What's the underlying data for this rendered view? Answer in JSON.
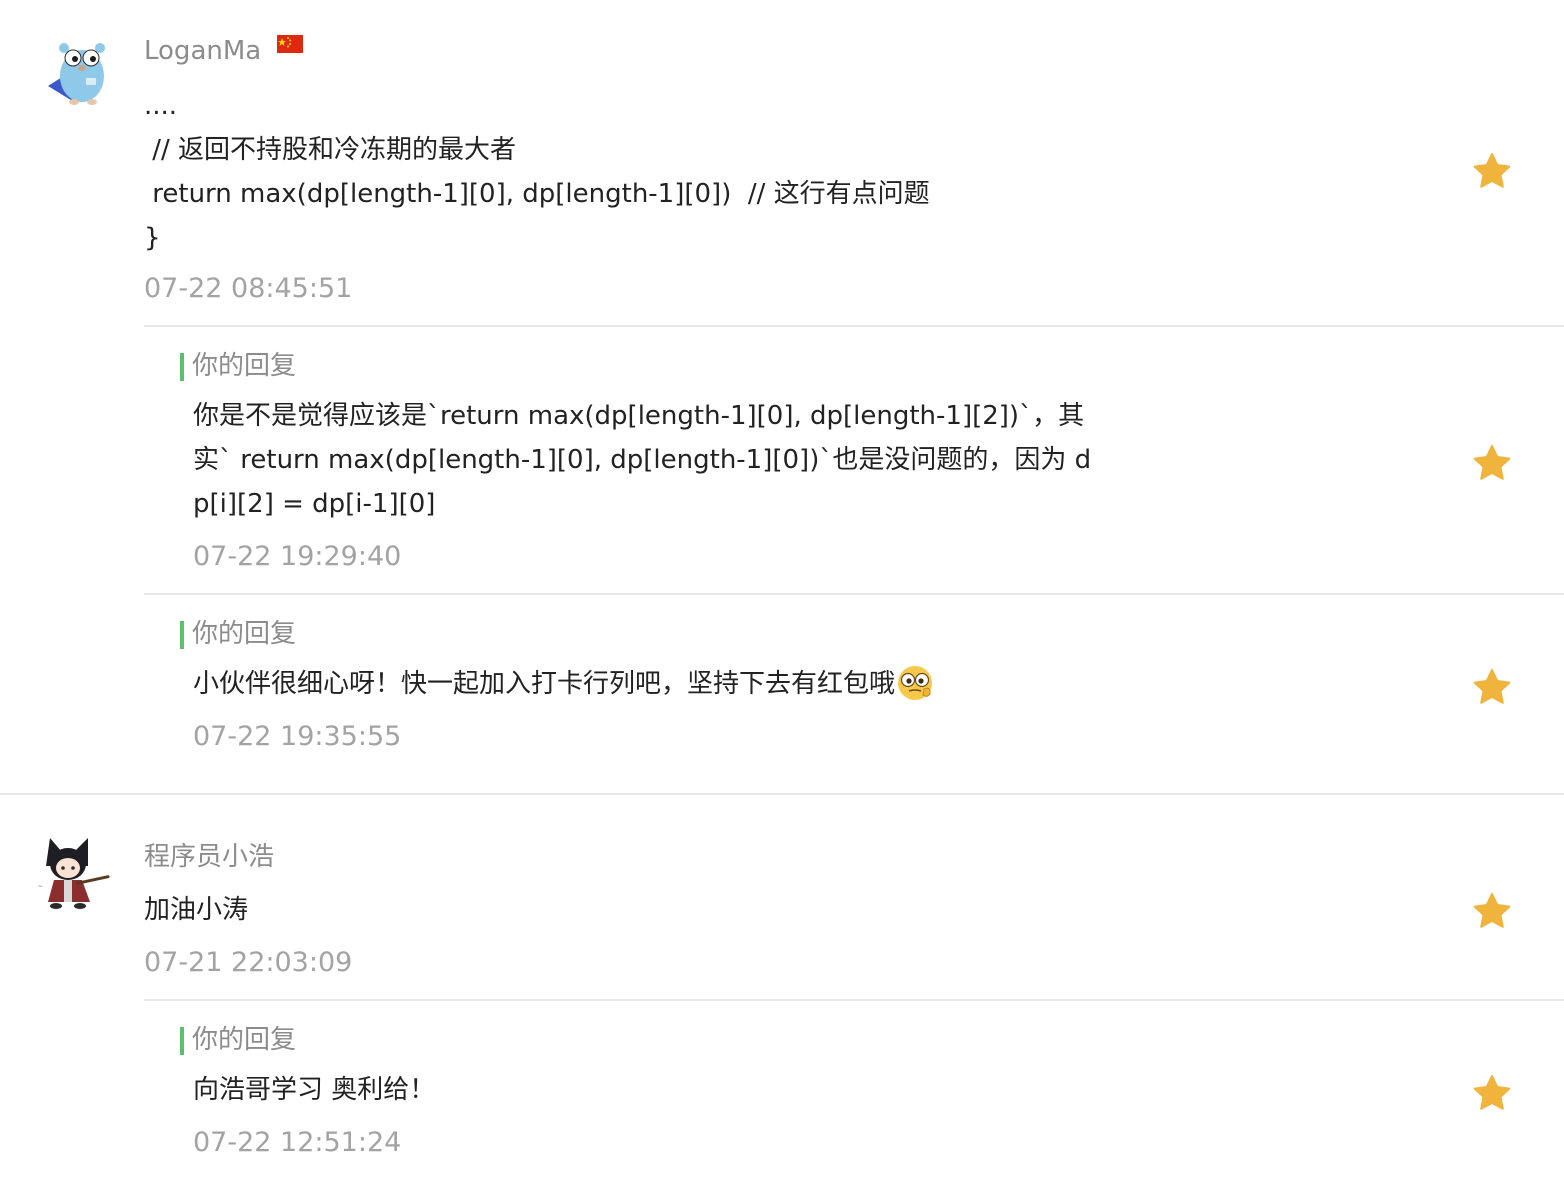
{
  "comments": [
    {
      "username": "LoganMa",
      "flag": "china-flag",
      "content_lines": [
        "....",
        " // 返回不持股和冷冻期的最大者",
        " return max(dp[length-1][0], dp[length-1][0])  // 这行有点问题",
        "}"
      ],
      "time": "07-22 08:45:51",
      "replies": [
        {
          "label": "你的回复",
          "lines": [
            "你是不是觉得应该是`return max(dp[length-1][0], dp[length-1][2])`，其",
            "实` return max(dp[length-1][0], dp[length-1][0])`也是没问题的，因为 d",
            "p[i][2] = dp[i-1][0]"
          ],
          "time": "07-22 19:29:40"
        },
        {
          "label": "你的回复",
          "lines": [
            "小伙伴很细心呀！快一起加入打卡行列吧，坚持下去有红包哦"
          ],
          "emoji": "thinking-eyes-emoji",
          "time": "07-22 19:35:55"
        }
      ]
    },
    {
      "username": "程序员小浩",
      "content_lines": [
        "加油小涛"
      ],
      "time": "07-21 22:03:09",
      "replies": [
        {
          "label": "你的回复",
          "lines": [
            "向浩哥学习 奥利给！"
          ],
          "time": "07-22 12:51:24"
        }
      ]
    }
  ],
  "icons": {
    "star": "star-icon",
    "avatar1": "gopher-avatar",
    "avatar2": "cat-girl-avatar"
  },
  "colors": {
    "star": "#f0b43c",
    "reply_bar": "#5cbf6a",
    "muted_text": "#8c8c8c",
    "time_text": "#a3a3a3"
  }
}
